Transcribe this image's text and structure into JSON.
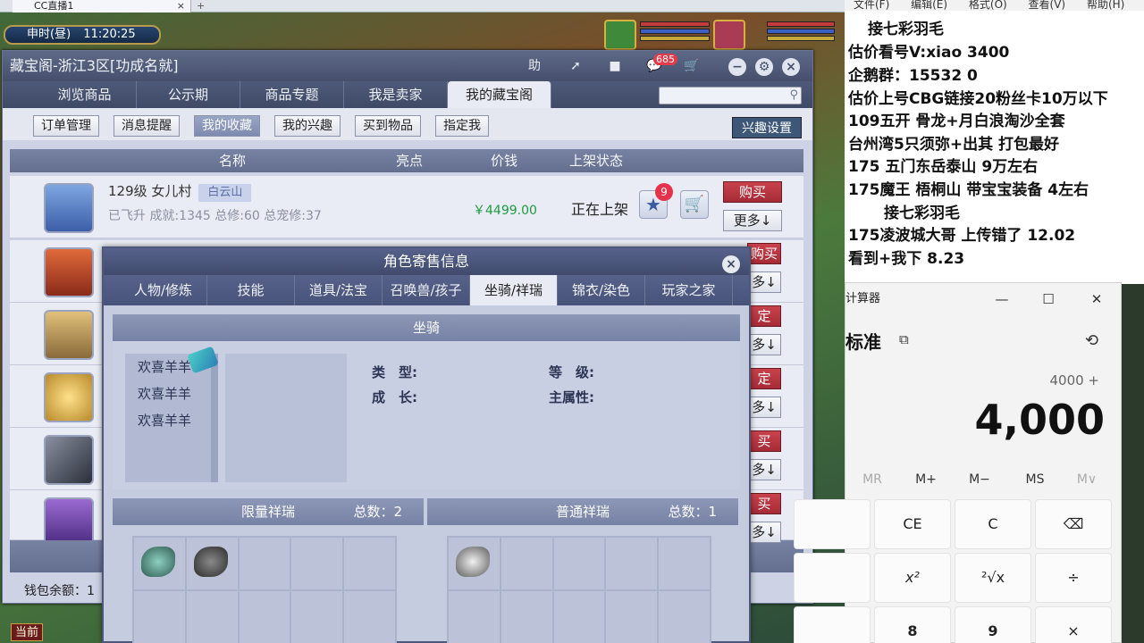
{
  "browser": {
    "tab_title": "CC直播1",
    "close": "×",
    "add": "+"
  },
  "hud": {
    "time_period": "申时(昼)",
    "clock": "11:20:25"
  },
  "window": {
    "title": "藏宝阁-浙江3区[功成名就]",
    "help_label": "助",
    "message_badge": "685",
    "nav_tabs": [
      "浏览商品",
      "公示期",
      "商品专题",
      "我是卖家",
      "我的藏宝阁"
    ],
    "sub_tabs": [
      "订单管理",
      "消息提醒",
      "我的收藏",
      "我的兴趣",
      "买到物品",
      "指定我"
    ],
    "interest_settings": "兴趣设置",
    "table_headers": {
      "name": "名称",
      "highlight": "亮点",
      "price": "价钱",
      "status": "上架状态"
    },
    "listing": {
      "title": "129级  女儿村",
      "server_tag": "白云山",
      "meta": "已飞升  成就:1345  总修:60  总宠修:37",
      "price": "￥4499.00",
      "status": "正在上架",
      "favorite_count": "9",
      "buy": "购买",
      "more": "更多↓"
    },
    "side_buttons": [
      "购买",
      "多↓",
      "定",
      "多↓",
      "定",
      "多↓",
      "买",
      "多↓",
      "买",
      "多↓"
    ],
    "wallet_label": "钱包余额：1"
  },
  "popup": {
    "title": "角色寄售信息",
    "tabs": [
      "人物/修炼",
      "技能",
      "道具/法宝",
      "召唤兽/孩子",
      "坐骑/祥瑞",
      "锦衣/染色",
      "玩家之家"
    ],
    "section_title": "坐骑",
    "mounts": [
      "欢喜羊羊",
      "欢喜羊羊",
      "欢喜羊羊"
    ],
    "attributes": {
      "type": "类　型:",
      "level": "等　级:",
      "growth": "成　长:",
      "main_attr": "主属性:"
    },
    "limited": {
      "title": "限量祥瑞",
      "total": "总数：2"
    },
    "normal": {
      "title": "普通祥瑞",
      "total": "总数：1"
    }
  },
  "overlay": {
    "menu": [
      "文件(F)",
      "编辑(E)",
      "格式(O)",
      "查看(V)",
      "帮助(H)"
    ],
    "notes": [
      "接七彩羽毛",
      "估价看号V:xiao   3400",
      "企鹅群：15532   0",
      "估价上号CBG链接20粉丝卡10万以下",
      "109五开 骨龙+月白浪淘沙全套",
      "台州湾5只须弥+出其 打包最好",
      "175 五门东岳泰山  9万左右",
      "175魔王 梧桐山  带宝宝装备 4左右",
      "接七彩羽毛",
      "175凌波城大哥 上传错了 12.02",
      "看到+我下  8.23"
    ]
  },
  "calculator": {
    "title": "计算器",
    "mode": "标准",
    "expression": "4000 +",
    "display": "4,000",
    "memory": [
      "MR",
      "M+",
      "M−",
      "MS",
      "M∨"
    ],
    "keys": [
      "CE",
      "C",
      "⌫",
      "x²",
      "²√x",
      "÷",
      "8",
      "9",
      "×"
    ]
  },
  "game_bottom": {
    "current_channel": "当前"
  },
  "colors": {
    "accent": "#46506d",
    "buy": "#a52b37",
    "price": "#1d9a42"
  }
}
